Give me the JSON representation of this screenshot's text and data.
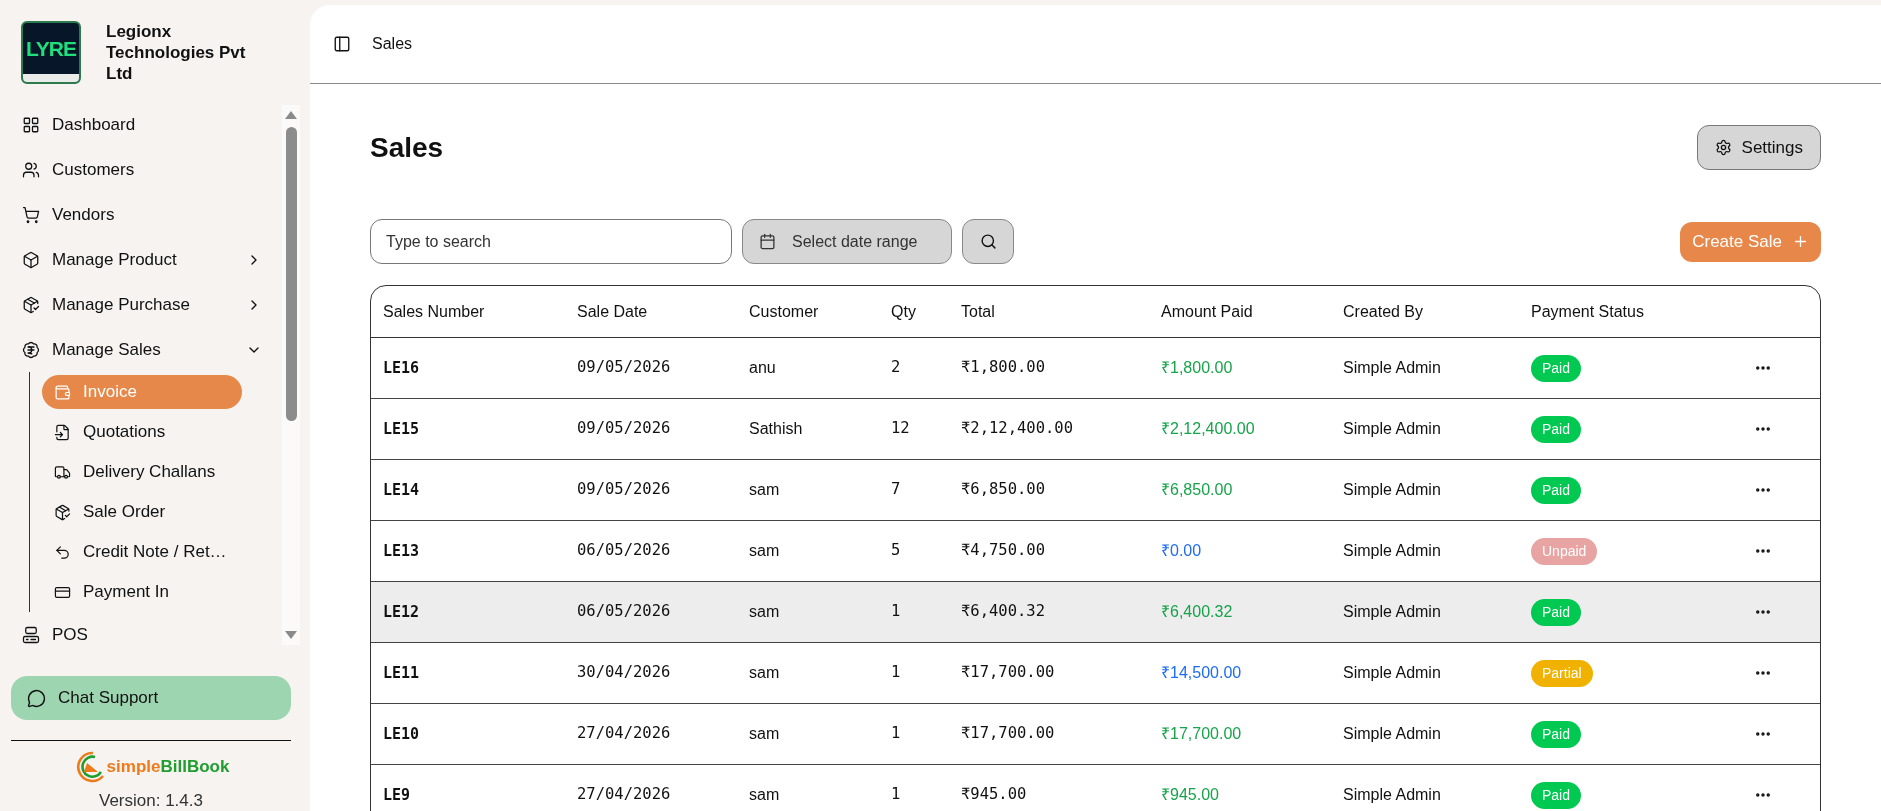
{
  "sidebar": {
    "company": {
      "logo_text": "LYRE",
      "name": "Legionx Technologies Pvt Ltd"
    },
    "items": [
      {
        "label": "Dashboard",
        "kind": "link",
        "selected": false
      },
      {
        "label": "Customers",
        "kind": "link",
        "selected": false
      },
      {
        "label": "Vendors",
        "kind": "link",
        "selected": false
      },
      {
        "label": "Manage Product",
        "kind": "group",
        "expanded": false,
        "selected": false
      },
      {
        "label": "Manage Purchase",
        "kind": "group",
        "expanded": false,
        "selected": false
      },
      {
        "label": "Manage Sales",
        "kind": "group",
        "expanded": true,
        "selected": false,
        "children": [
          {
            "label": "Invoice",
            "selected": true
          },
          {
            "label": "Quotations",
            "selected": false
          },
          {
            "label": "Delivery Challans",
            "selected": false
          },
          {
            "label": "Sale Order",
            "selected": false
          },
          {
            "label": "Credit Note / Ret…",
            "selected": false
          },
          {
            "label": "Payment In",
            "selected": false
          }
        ]
      },
      {
        "label": "POS",
        "kind": "link",
        "selected": false
      }
    ],
    "chat_button": "Chat Support",
    "brand": {
      "parts": [
        "simple",
        "BillBook"
      ]
    },
    "version": "Version: 1.4.3"
  },
  "header": {
    "breadcrumb": "Sales"
  },
  "page": {
    "title": "Sales",
    "settings_button": "Settings",
    "search": {
      "placeholder": "Type to search"
    },
    "date_range_button": "Select date range",
    "create_button": "Create Sale"
  },
  "table": {
    "columns": [
      "Sales Number",
      "Sale Date",
      "Customer",
      "Qty",
      "Total",
      "Amount Paid",
      "Created By",
      "Payment Status"
    ],
    "rows": [
      {
        "sales_number": "LE16",
        "sale_date": "09/05/2026",
        "customer": "anu",
        "qty": "2",
        "total": "₹1,800.00",
        "amount_paid": {
          "value": "₹1,800.00",
          "color": "#16a34a"
        },
        "created_by": "Simple Admin",
        "status": {
          "label": "Paid",
          "color": "#00c951"
        },
        "highlighted": false
      },
      {
        "sales_number": "LE15",
        "sale_date": "09/05/2026",
        "customer": "Sathish",
        "qty": "12",
        "total": "₹2,12,400.00",
        "amount_paid": {
          "value": "₹2,12,400.00",
          "color": "#16a34a"
        },
        "created_by": "Simple Admin",
        "status": {
          "label": "Paid",
          "color": "#00c951"
        },
        "highlighted": false
      },
      {
        "sales_number": "LE14",
        "sale_date": "09/05/2026",
        "customer": "sam",
        "qty": "7",
        "total": "₹6,850.00",
        "amount_paid": {
          "value": "₹6,850.00",
          "color": "#16a34a"
        },
        "created_by": "Simple Admin",
        "status": {
          "label": "Paid",
          "color": "#00c951"
        },
        "highlighted": false
      },
      {
        "sales_number": "LE13",
        "sale_date": "06/05/2026",
        "customer": "sam",
        "qty": "5",
        "total": "₹4,750.00",
        "amount_paid": {
          "value": "₹0.00",
          "color": "#1d6cf2"
        },
        "created_by": "Simple Admin",
        "status": {
          "label": "Unpaid",
          "color": "#e8a3a3"
        },
        "highlighted": false
      },
      {
        "sales_number": "LE12",
        "sale_date": "06/05/2026",
        "customer": "sam",
        "qty": "1",
        "total": "₹6,400.32",
        "amount_paid": {
          "value": "₹6,400.32",
          "color": "#16a34a"
        },
        "created_by": "Simple Admin",
        "status": {
          "label": "Paid",
          "color": "#00c951"
        },
        "highlighted": true
      },
      {
        "sales_number": "LE11",
        "sale_date": "30/04/2026",
        "customer": "sam",
        "qty": "1",
        "total": "₹17,700.00",
        "amount_paid": {
          "value": "₹14,500.00",
          "color": "#1d6cf2"
        },
        "created_by": "Simple Admin",
        "status": {
          "label": "Partial",
          "color": "#f0b100"
        },
        "highlighted": false
      },
      {
        "sales_number": "LE10",
        "sale_date": "27/04/2026",
        "customer": "sam",
        "qty": "1",
        "total": "₹17,700.00",
        "amount_paid": {
          "value": "₹17,700.00",
          "color": "#16a34a"
        },
        "created_by": "Simple Admin",
        "status": {
          "label": "Paid",
          "color": "#00c951"
        },
        "highlighted": false
      },
      {
        "sales_number": "LE9",
        "sale_date": "27/04/2026",
        "customer": "sam",
        "qty": "1",
        "total": "₹945.00",
        "amount_paid": {
          "value": "₹945.00",
          "color": "#16a34a"
        },
        "created_by": "Simple Admin",
        "status": {
          "label": "Paid",
          "color": "#00c951"
        },
        "highlighted": false
      }
    ]
  }
}
